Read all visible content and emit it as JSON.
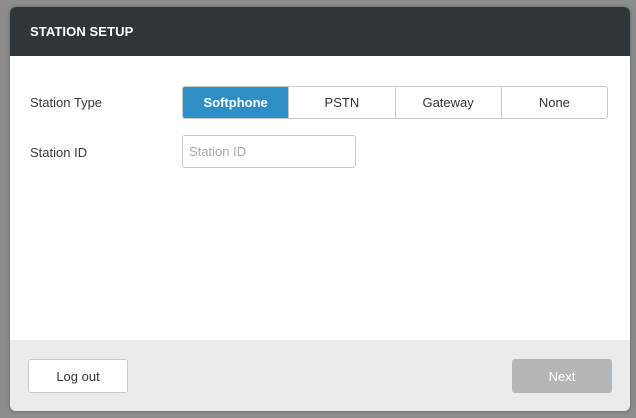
{
  "dialog": {
    "title": "STATION SETUP"
  },
  "form": {
    "station_type_label": "Station Type",
    "station_type_options": [
      "Softphone",
      "PSTN",
      "Gateway",
      "None"
    ],
    "station_type_selected": "Softphone",
    "station_id_label": "Station ID",
    "station_id_value": "",
    "station_id_placeholder": "Station ID"
  },
  "footer": {
    "logout_label": "Log out",
    "next_label": "Next",
    "next_disabled": true
  },
  "colors": {
    "header_bg": "#2f3538",
    "accent": "#2f8fc4",
    "footer_bg": "#ebebeb",
    "disabled_button": "#b3b7ba"
  }
}
